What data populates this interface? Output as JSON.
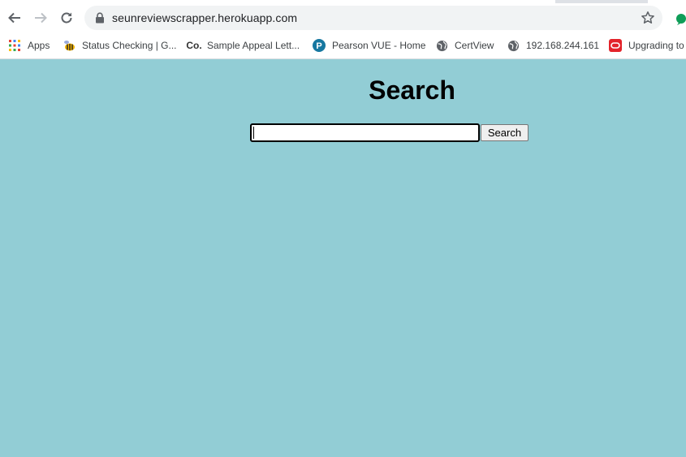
{
  "browser": {
    "url": "seunreviewscrapper.herokuapp.com"
  },
  "bookmarks": [
    {
      "label": "Apps",
      "icon": "apps-grid-icon"
    },
    {
      "label": "Status Checking | G...",
      "icon": "bee-icon"
    },
    {
      "label": "Sample Appeal Lett...",
      "icon": "co-logo-icon"
    },
    {
      "label": "Pearson VUE - Home",
      "icon": "pearson-p-icon"
    },
    {
      "label": "CertView",
      "icon": "globe-icon"
    },
    {
      "label": "192.168.244.161",
      "icon": "globe-icon"
    },
    {
      "label": "Upgrading to",
      "icon": "oracle-icon"
    }
  ],
  "page": {
    "title": "Search",
    "search_value": "",
    "search_button": "Search",
    "background": "#92cdd5"
  }
}
